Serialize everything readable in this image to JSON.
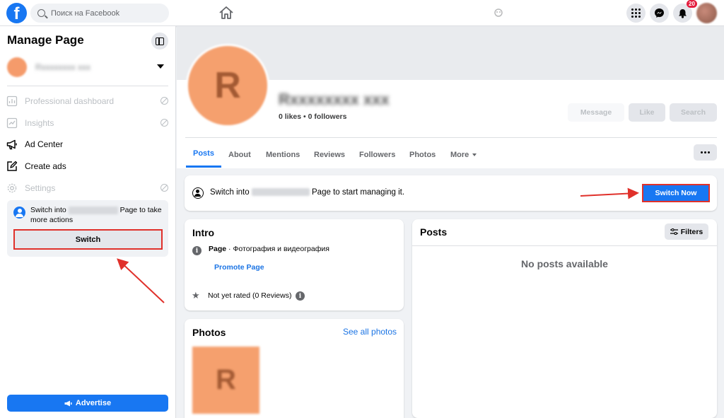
{
  "topbar": {
    "logo": "f",
    "search_placeholder": "Поиск на Facebook",
    "notifications_count": "20",
    "icons": [
      "home-icon",
      "apps-grid-icon",
      "messenger-icon",
      "bell-icon"
    ]
  },
  "sidebar": {
    "title": "Manage Page",
    "items": [
      {
        "label": "Professional dashboard",
        "disabled": true
      },
      {
        "label": "Insights",
        "disabled": true
      },
      {
        "label": "Ad Center",
        "disabled": false
      },
      {
        "label": "Create ads",
        "disabled": false
      },
      {
        "label": "Settings",
        "disabled": true
      }
    ],
    "switch_card": {
      "text_prefix": "Switch into",
      "text_suffix": "Page to take more actions",
      "button": "Switch"
    },
    "advertise_button": "Advertise"
  },
  "profile": {
    "initial": "R",
    "stats": "0 likes • 0 followers",
    "actions": {
      "message": "Message",
      "like": "Like",
      "search": "Search"
    }
  },
  "tabs": [
    "Posts",
    "About",
    "Mentions",
    "Reviews",
    "Followers",
    "Photos",
    "More"
  ],
  "banner": {
    "text_prefix": "Switch into",
    "text_suffix": "Page to start managing it.",
    "button": "Switch Now"
  },
  "intro": {
    "title": "Intro",
    "category_label": "Page",
    "category_value": " · Фотография и видеография",
    "promote": "Promote Page",
    "rating": "Not yet rated (0 Reviews)"
  },
  "photos": {
    "title": "Photos",
    "see_all": "See all photos"
  },
  "posts": {
    "title": "Posts",
    "filters": "Filters",
    "empty": "No posts available"
  },
  "colors": {
    "accent": "#1877f2",
    "highlight": "#e0312b",
    "avatar": "#f5a06e"
  }
}
